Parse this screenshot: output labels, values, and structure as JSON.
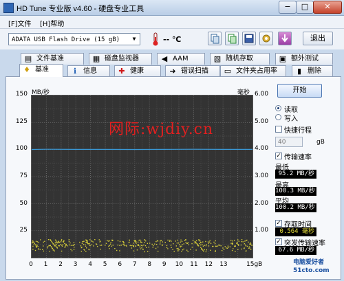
{
  "window": {
    "title": "HD Tune 专业版 v4.60 - 硬盘专业工具",
    "minimize": "−",
    "maximize": "□",
    "close": "✕"
  },
  "menu": {
    "file": "[F]文件",
    "help": "[H]帮助"
  },
  "toolbar": {
    "drive": "ADATA   USB Flash Drive  (15 gB)",
    "temp": "-- ℃",
    "exit_label": "退出"
  },
  "tabs_top": [
    {
      "label": "文件基准",
      "icon": "file-icon"
    },
    {
      "label": "磁盘监视器",
      "icon": "monitor-icon"
    },
    {
      "label": "AAM",
      "icon": "speaker-icon"
    },
    {
      "label": "随机存取",
      "icon": "random-access-icon"
    },
    {
      "label": "额外测试",
      "icon": "extra-test-icon"
    }
  ],
  "tabs_bottom": [
    {
      "label": "基准",
      "icon": "benchmark-icon"
    },
    {
      "label": "信息",
      "icon": "info-icon"
    },
    {
      "label": "健康",
      "icon": "health-icon"
    },
    {
      "label": "错误扫描",
      "icon": "error-scan-icon"
    },
    {
      "label": "文件夹占用率",
      "icon": "folder-icon"
    },
    {
      "label": "删除",
      "icon": "delete-icon"
    }
  ],
  "chart_data": {
    "type": "line",
    "y_left_label": "MB/秒",
    "y_right_label": "毫秒",
    "y_left_ticks": [
      "150",
      "125",
      "100",
      "75",
      "50",
      "25"
    ],
    "y_right_ticks": [
      "6.00",
      "5.00",
      "4.00",
      "3.00",
      "2.00",
      "1.00"
    ],
    "x_ticks": [
      "0",
      "1",
      "2",
      "3",
      "4",
      "5",
      "6",
      "7",
      "8",
      "9",
      "10",
      "11",
      "12",
      "13",
      "15gB"
    ],
    "ylim_left": [
      0,
      150
    ],
    "ylim_right": [
      0,
      6
    ],
    "xlim": [
      0,
      15
    ],
    "series": [
      {
        "color": "#3a9ad9",
        "x": [
          0,
          1,
          3,
          5,
          7,
          9,
          11,
          13,
          15
        ],
        "y": [
          100.1,
          100.3,
          100.2,
          100.2,
          100.1,
          100.2,
          100.3,
          100.2,
          100.2
        ]
      },
      {
        "color": "#d8cf3a",
        "x": [
          0,
          15
        ],
        "y": [
          0.56,
          0.56
        ]
      }
    ]
  },
  "watermark": "网际:wjdiy.cn",
  "side": {
    "start": "开始",
    "read": "读取",
    "write": "写入",
    "short_stroke": "快捷行程",
    "short_value": "40",
    "short_unit": "gB",
    "transfer_rate": "传输速率",
    "min_label": "最低",
    "min_value": "95.2 MB/秒",
    "max_label": "最高",
    "max_value": "100.3 MB/秒",
    "avg_label": "平均",
    "avg_value": "100.2 MB/秒",
    "access_time": "存取时间",
    "access_value": "0.564 毫秒",
    "burst_rate": "突发传输速率",
    "burst_value": "67.6 MB/秒"
  },
  "logo": "电脑爱好者 51cto.com"
}
